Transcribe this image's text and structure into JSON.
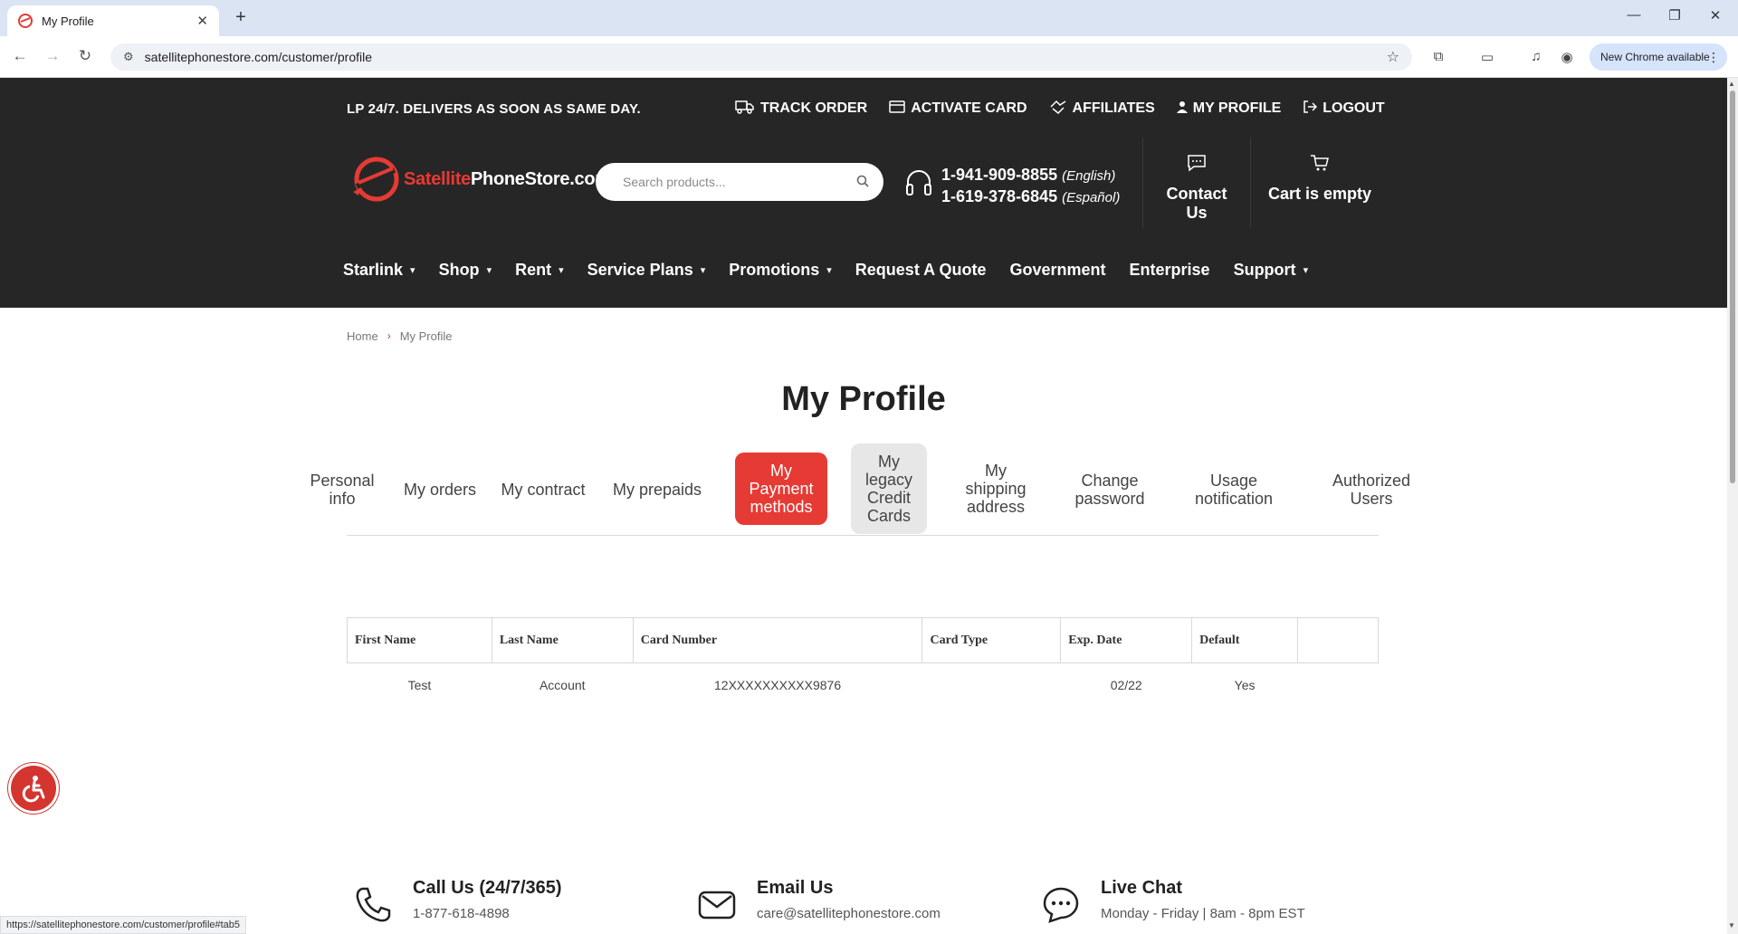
{
  "browser": {
    "tab_title": "My Profile",
    "tab_close": "✕",
    "new_tab": "+",
    "url": "satellitephonestore.com/customer/profile",
    "new_chrome_label": "New Chrome available",
    "status_url": "https://satellitephonestore.com/customer/profile#tab5"
  },
  "site": {
    "topstrip": "LP 24/7. DELIVERS AS SOON AS SAME DAY.",
    "top_links": [
      "TRACK ORDER",
      "ACTIVATE CARD",
      "AFFILIATES",
      "MY PROFILE",
      "LOGOUT"
    ],
    "logo_part1": "Satellite",
    "logo_part2": "PhoneStore.com",
    "search_placeholder": "Search products...",
    "phone1": "1-941-909-8855",
    "phone1_lang": "(English)",
    "phone2": "1-619-378-6845",
    "phone2_lang": "(Español)",
    "contact_label": "Contact Us",
    "cart_label": "Cart is empty",
    "nav": [
      "Starlink",
      "Shop",
      "Rent",
      "Service Plans",
      "Promotions",
      "Request A Quote",
      "Government",
      "Enterprise",
      "Support"
    ]
  },
  "breadcrumb": {
    "home": "Home",
    "current": "My Profile",
    "sep": "›"
  },
  "page_title": "My Profile",
  "profile_tabs": [
    {
      "label": "Personal info"
    },
    {
      "label": "My orders"
    },
    {
      "label": "My contract"
    },
    {
      "label": "My prepaids"
    },
    {
      "label": "My Payment methods",
      "state": "active"
    },
    {
      "label": "My legacy Credit Cards",
      "state": "hover"
    },
    {
      "label": "My shipping address"
    },
    {
      "label": "Change password"
    },
    {
      "label": "Usage notification"
    },
    {
      "label": "Authorized Users"
    }
  ],
  "payment_table": {
    "headers": [
      "First Name",
      "Last Name",
      "Card Number",
      "Card Type",
      "Exp. Date",
      "Default",
      ""
    ],
    "rows": [
      [
        "Test",
        "Account",
        "12XXXXXXXXXX9876",
        "",
        "02/22",
        "Yes",
        ""
      ]
    ]
  },
  "footer": {
    "call_title": "Call Us (24/7/365)",
    "call_value": "1-877-618-4898",
    "email_title": "Email Us",
    "email_value": "care@satellitephonestore.com",
    "chat_title": "Live Chat",
    "chat_value": "Monday - Friday | 8am - 8pm EST"
  },
  "colors": {
    "brand_red": "#e63a34",
    "header_bg": "#262626"
  }
}
